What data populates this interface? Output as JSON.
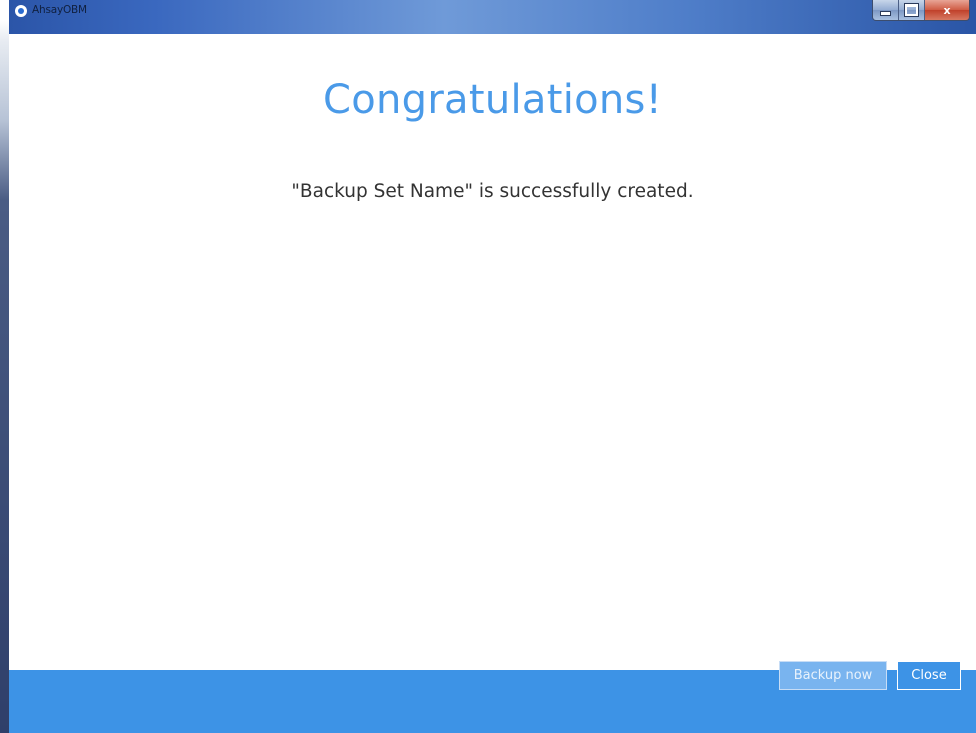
{
  "window": {
    "title": "AhsayOBM",
    "controls": {
      "minimize_icon": "minimize-icon",
      "maximize_icon": "maximize-icon",
      "close_glyph": "x"
    }
  },
  "main": {
    "heading": "Congratulations!",
    "message": "\"Backup Set Name\" is successfully created."
  },
  "footer": {
    "backup_now_label": "Backup now",
    "close_label": "Close"
  },
  "colors": {
    "accent": "#3d93e6",
    "heading": "#4a9ae8",
    "text": "#333333"
  }
}
